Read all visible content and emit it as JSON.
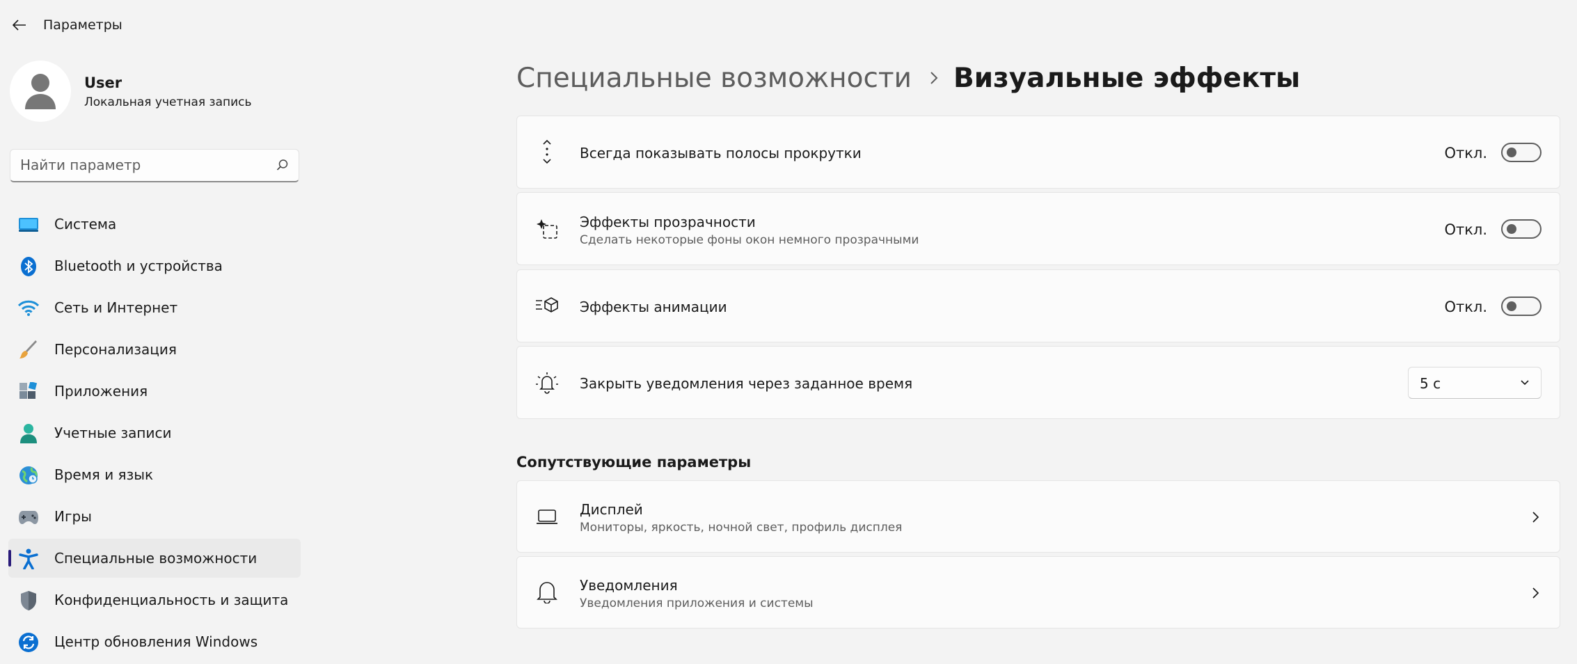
{
  "app": {
    "title": "Параметры"
  },
  "profile": {
    "name": "User",
    "account_type": "Локальная учетная запись"
  },
  "search": {
    "placeholder": "Найти параметр"
  },
  "sidebar": {
    "items": [
      {
        "label": "Система",
        "icon": "system-icon"
      },
      {
        "label": "Bluetooth и устройства",
        "icon": "bluetooth-icon"
      },
      {
        "label": "Сеть и Интернет",
        "icon": "wifi-icon"
      },
      {
        "label": "Персонализация",
        "icon": "brush-icon"
      },
      {
        "label": "Приложения",
        "icon": "apps-icon"
      },
      {
        "label": "Учетные записи",
        "icon": "account-icon"
      },
      {
        "label": "Время и язык",
        "icon": "globe-icon"
      },
      {
        "label": "Игры",
        "icon": "gamepad-icon"
      },
      {
        "label": "Специальные возможности",
        "icon": "accessibility-icon",
        "active": true
      },
      {
        "label": "Конфиденциальность и защита",
        "icon": "shield-icon"
      },
      {
        "label": "Центр обновления Windows",
        "icon": "update-icon"
      }
    ]
  },
  "breadcrumb": {
    "parent": "Специальные возможности",
    "current": "Визуальные эффекты"
  },
  "settings": [
    {
      "title": "Всегда показывать полосы прокрутки",
      "state": "Откл.",
      "icon": "scrollbar-icon"
    },
    {
      "title": "Эффекты прозрачности",
      "subtitle": "Сделать некоторые фоны окон немного прозрачными",
      "state": "Откл.",
      "icon": "transparency-icon"
    },
    {
      "title": "Эффекты анимации",
      "state": "Откл.",
      "icon": "animation-icon"
    },
    {
      "title": "Закрыть уведомления через заданное время",
      "value": "5 с",
      "icon": "notification-timer-icon"
    }
  ],
  "related": {
    "title": "Сопутствующие параметры",
    "items": [
      {
        "title": "Дисплей",
        "subtitle": "Мониторы, яркость, ночной свет, профиль дисплея",
        "icon": "laptop-icon"
      },
      {
        "title": "Уведомления",
        "subtitle": "Уведомления приложения и системы",
        "icon": "bell-icon"
      }
    ]
  },
  "colors": {
    "background": "#f3f3f3",
    "card": "#fbfbfb",
    "accent_indicator": "#2a1b7a"
  }
}
